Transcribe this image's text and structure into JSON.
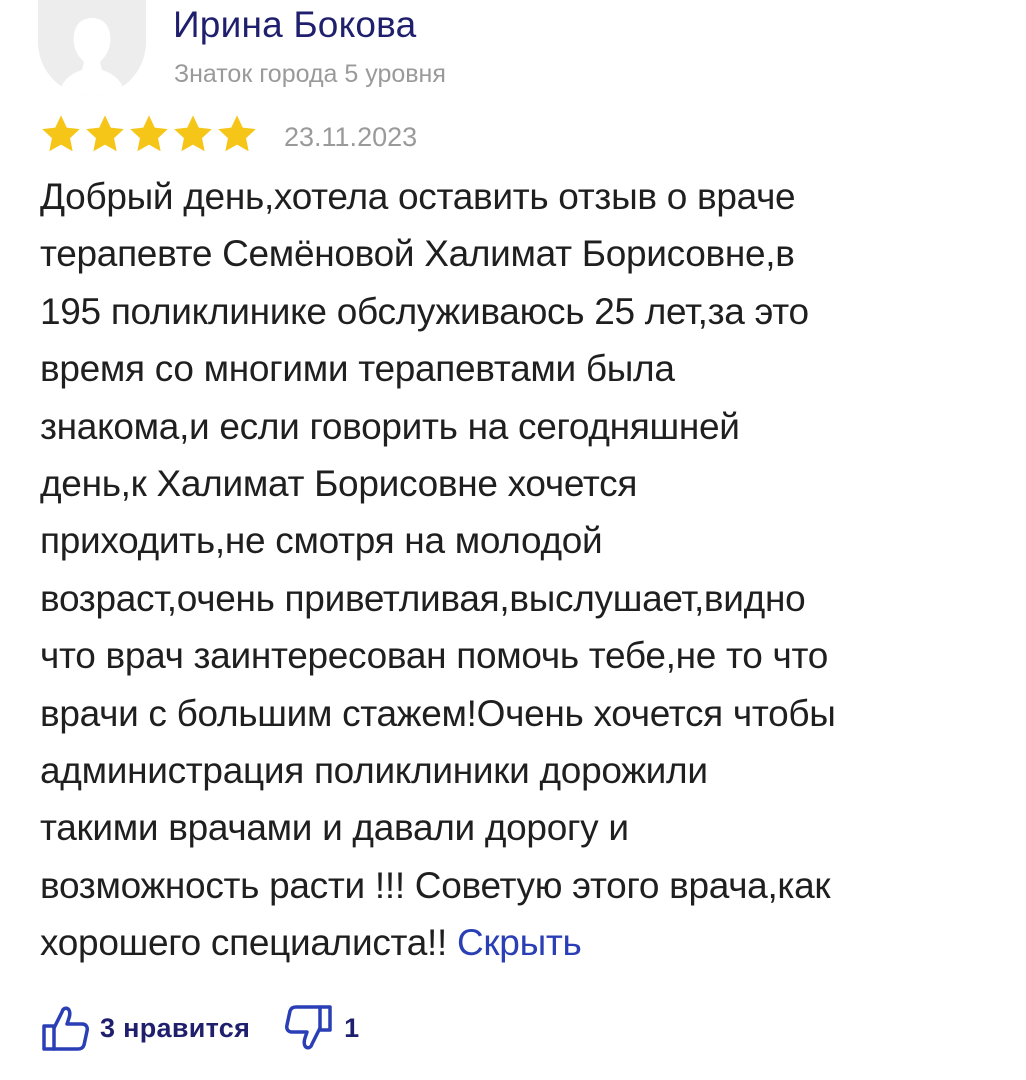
{
  "author": {
    "name": "Ирина Бокова",
    "level": "Знаток города 5 уровня",
    "avatar_icon": "user-silhouette-icon"
  },
  "rating": {
    "stars": 5,
    "max": 5,
    "color": "#f5c518",
    "date": "23.11.2023"
  },
  "review": {
    "lines": [
      "Добрый день,хотела оставить отзыв о враче",
      "терапевте Семёновой Халимат Борисовне,в",
      "195 поликлинике обслуживаюсь 25 лет,за это",
      "время со многими терапевтами была",
      "знакома,и если говорить на сегодняшней",
      "день,к Халимат Борисовне хочется",
      "приходить,не смотря на молодой",
      "возраст,очень приветливая,выслушает,видно",
      "что врач заинтересован помочь тебе,не то что",
      "врачи с большим стажем!Очень хочется чтобы",
      "администрация поликлиники дорожили",
      "такими врачами и давали дорогу и",
      "возможность расти !!! Советую этого врача,как",
      "хорошего специалиста!!"
    ],
    "hide_link": "Скрыть"
  },
  "reactions": {
    "like_label": "3 нравится",
    "like_icon": "thumbs-up-icon",
    "dislike_count": "1",
    "dislike_icon": "thumbs-down-icon"
  },
  "colors": {
    "author_name": "#1f1f6e",
    "link": "#2a3fb5",
    "muted": "#9a9a9a"
  }
}
